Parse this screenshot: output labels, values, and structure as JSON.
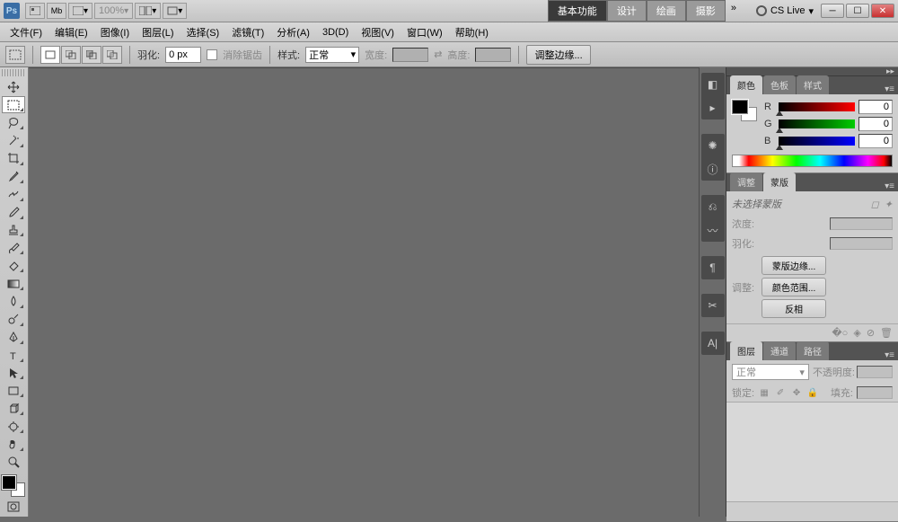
{
  "app": {
    "logo": "Ps"
  },
  "titlebar": {
    "zoom": "100%",
    "workspaces": [
      "基本功能",
      "设计",
      "绘画",
      "摄影"
    ],
    "more": "»",
    "cslive": "CS Live"
  },
  "menu": {
    "items": [
      "文件(F)",
      "编辑(E)",
      "图像(I)",
      "图层(L)",
      "选择(S)",
      "滤镜(T)",
      "分析(A)",
      "3D(D)",
      "视图(V)",
      "窗口(W)",
      "帮助(H)"
    ]
  },
  "options": {
    "feather_label": "羽化:",
    "feather_value": "0 px",
    "antialias": "消除锯齿",
    "style_label": "样式:",
    "style_value": "正常",
    "width_label": "宽度:",
    "height_label": "高度:",
    "refine_edge": "调整边缘..."
  },
  "color_panel": {
    "tabs": [
      "颜色",
      "色板",
      "样式"
    ],
    "r_label": "R",
    "r_value": "0",
    "g_label": "G",
    "g_value": "0",
    "b_label": "B",
    "b_value": "0"
  },
  "mask_panel": {
    "tabs": [
      "调整",
      "蒙版"
    ],
    "no_mask": "未选择蒙版",
    "density": "浓度:",
    "feather": "羽化:",
    "adjust": "调整:",
    "mask_edge": "蒙版边缘...",
    "color_range": "颜色范围...",
    "invert": "反相"
  },
  "layers_panel": {
    "tabs": [
      "图层",
      "通道",
      "路径"
    ],
    "blend_mode": "正常",
    "opacity_label": "不透明度:",
    "lock_label": "锁定:",
    "fill_label": "填充:"
  }
}
